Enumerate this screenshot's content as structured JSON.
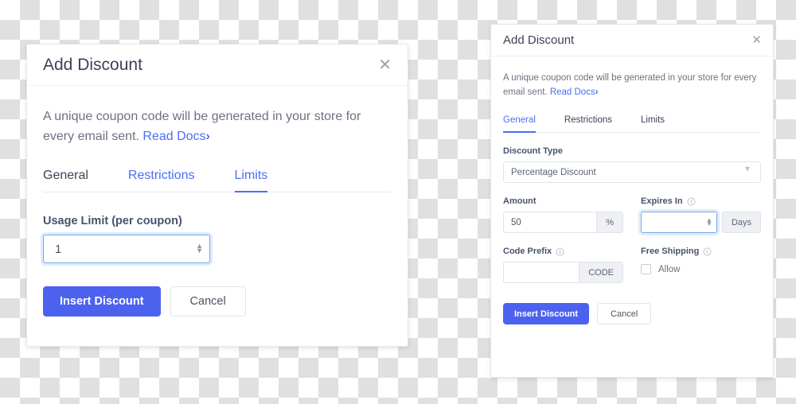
{
  "theme": {
    "accent_blue": "#4c6ef5",
    "button_blue": "#4c62ef",
    "focus_blue": "#74a8f0",
    "label_gray": "#47536b",
    "body_gray": "#6b7280",
    "checker_gray": "#e0e0e0"
  },
  "left_dialog": {
    "title": "Add Discount",
    "close_icon": "close-icon",
    "intro_text": "A unique coupon code will be generated in your store for every email sent.",
    "read_docs_label": "Read Docs",
    "read_docs_chevron": "›",
    "tabs": [
      {
        "label": "General",
        "active": false,
        "style": "dark"
      },
      {
        "label": "Restrictions",
        "active": false,
        "style": "blue"
      },
      {
        "label": "Limits",
        "active": true,
        "style": "blue"
      }
    ],
    "usage_limit": {
      "label": "Usage Limit (per coupon)",
      "value": "1",
      "placeholder": "",
      "focused": true,
      "stepper_up": "▲",
      "stepper_down": "▼"
    },
    "buttons": {
      "primary_label": "Insert Discount",
      "secondary_label": "Cancel"
    }
  },
  "right_dialog": {
    "title": "Add Discount",
    "close_icon": "close-icon",
    "intro_text": "A unique coupon code will be generated in your store for every email sent.",
    "read_docs_label": "Read Docs",
    "read_docs_chevron": "›",
    "tabs": [
      {
        "label": "General",
        "active": true,
        "style": "blue"
      },
      {
        "label": "Restrictions",
        "active": false,
        "style": "dark"
      },
      {
        "label": "Limits",
        "active": false,
        "style": "dark"
      }
    ],
    "discount_type": {
      "label": "Discount Type",
      "selected": "Percentage Discount",
      "options": [
        "Percentage Discount"
      ],
      "caret_icon": "chevron-down-icon"
    },
    "amount": {
      "label": "Amount",
      "value": "50",
      "placeholder": "",
      "suffix": "%",
      "focused": false
    },
    "expires_in": {
      "label": "Expires In",
      "info_icon": "info-icon",
      "value": "",
      "placeholder": "",
      "suffix": "Days",
      "focused": true,
      "stepper_up": "▲",
      "stepper_down": "▼"
    },
    "code_prefix": {
      "label": "Code Prefix",
      "info_icon": "info-icon",
      "value": "",
      "placeholder": "",
      "suffix": "CODE",
      "focused": false
    },
    "free_shipping": {
      "label": "Free Shipping",
      "info_icon": "info-icon",
      "checkbox_label": "Allow",
      "checked": false
    },
    "buttons": {
      "primary_label": "Insert Discount",
      "secondary_label": "Cancel"
    }
  }
}
